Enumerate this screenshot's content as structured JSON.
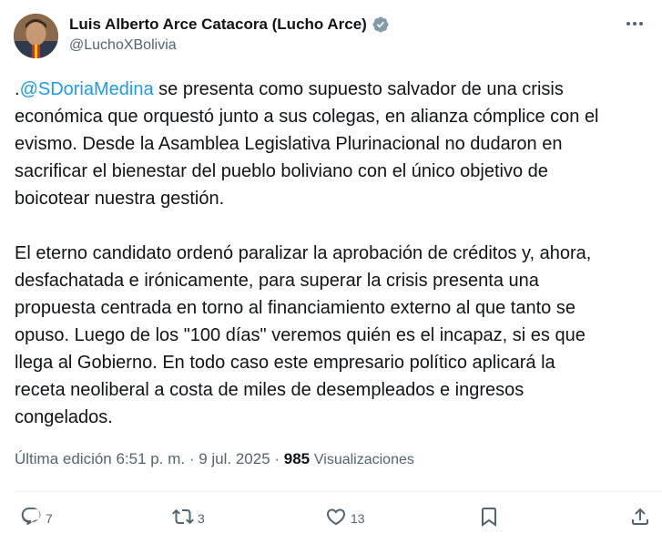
{
  "author": {
    "name": "Luis Alberto Arce Catacora (Lucho Arce)",
    "handle": "@LuchoXBolivia",
    "verified_color": "#829aab"
  },
  "tweet": {
    "paragraph1_prefix": ".",
    "mention": "@SDoriaMedina",
    "paragraph1_line1_rest": " se presenta como supuesto salvador de una crisis",
    "paragraph1_lines": [
      "económica que orquestó junto a sus colegas, en alianza cómplice con el",
      "evismo. Desde la Asamblea Legislativa Plurinacional no dudaron en",
      "sacrificar el bienestar del pueblo boliviano con el único objetivo de",
      "boicotear nuestra gestión."
    ],
    "paragraph2_lines": [
      "El eterno candidato ordenó paralizar la aprobación de créditos y, ahora,",
      "desfachatada e irónicamente, para superar la crisis presenta una",
      "propuesta centrada en torno al financiamiento externo al que tanto se",
      "opuso. Luego de los \"100 días\" veremos quién es el incapaz, si es que",
      "llega al Gobierno. En todo caso este empresario político aplicará la",
      "receta neoliberal a costa de miles de desempleados e ingresos",
      "congelados."
    ]
  },
  "meta": {
    "edited": "Última edición 6:51 p. m.",
    "separator": " · ",
    "date": "9 jul. 2025",
    "views_count": "985",
    "views_label": "Visualizaciones"
  },
  "actions": {
    "replies": "7",
    "reposts": "3",
    "likes": "13"
  },
  "colors": {
    "link": "#1d9bf0",
    "secondary_text": "#536471",
    "primary_text": "#0f1419"
  },
  "icons": [
    "verified-badge-icon",
    "more-icon",
    "reply-icon",
    "repost-icon",
    "like-icon",
    "bookmark-icon",
    "share-icon"
  ]
}
